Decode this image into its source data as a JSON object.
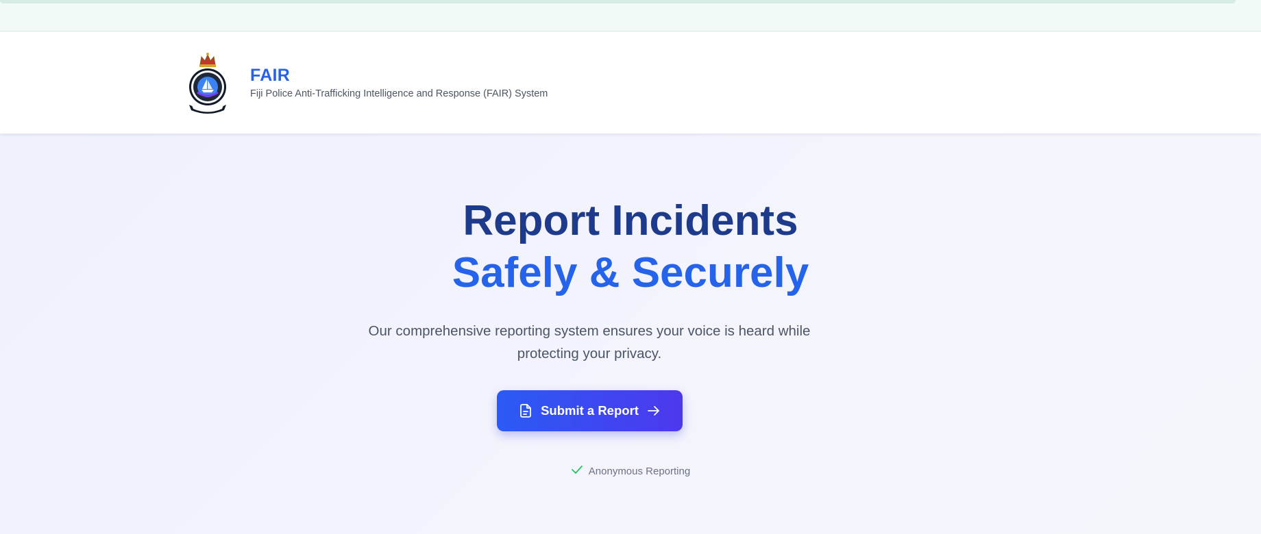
{
  "header": {
    "title": "FAIR",
    "subtitle": "Fiji Police Anti-Trafficking Intelligence and Response (FAIR) System",
    "logo_icon": "police-crest-icon"
  },
  "hero": {
    "line1": "Report Incidents",
    "line2": "Safely & Securely",
    "description": "Our comprehensive reporting system ensures your voice is heard while protecting your privacy.",
    "cta_label": "Submit a Report",
    "cta_icons": [
      "document-icon",
      "arrow-right-icon"
    ],
    "feature": "Anonymous Reporting",
    "feature_icon": "check-icon"
  },
  "colors": {
    "brand_blue": "#2563eb",
    "heading_navy": "#1e3a8a",
    "cta_start": "#2a5bf5",
    "cta_end": "#4d38ee",
    "check_green": "#22c55e"
  }
}
